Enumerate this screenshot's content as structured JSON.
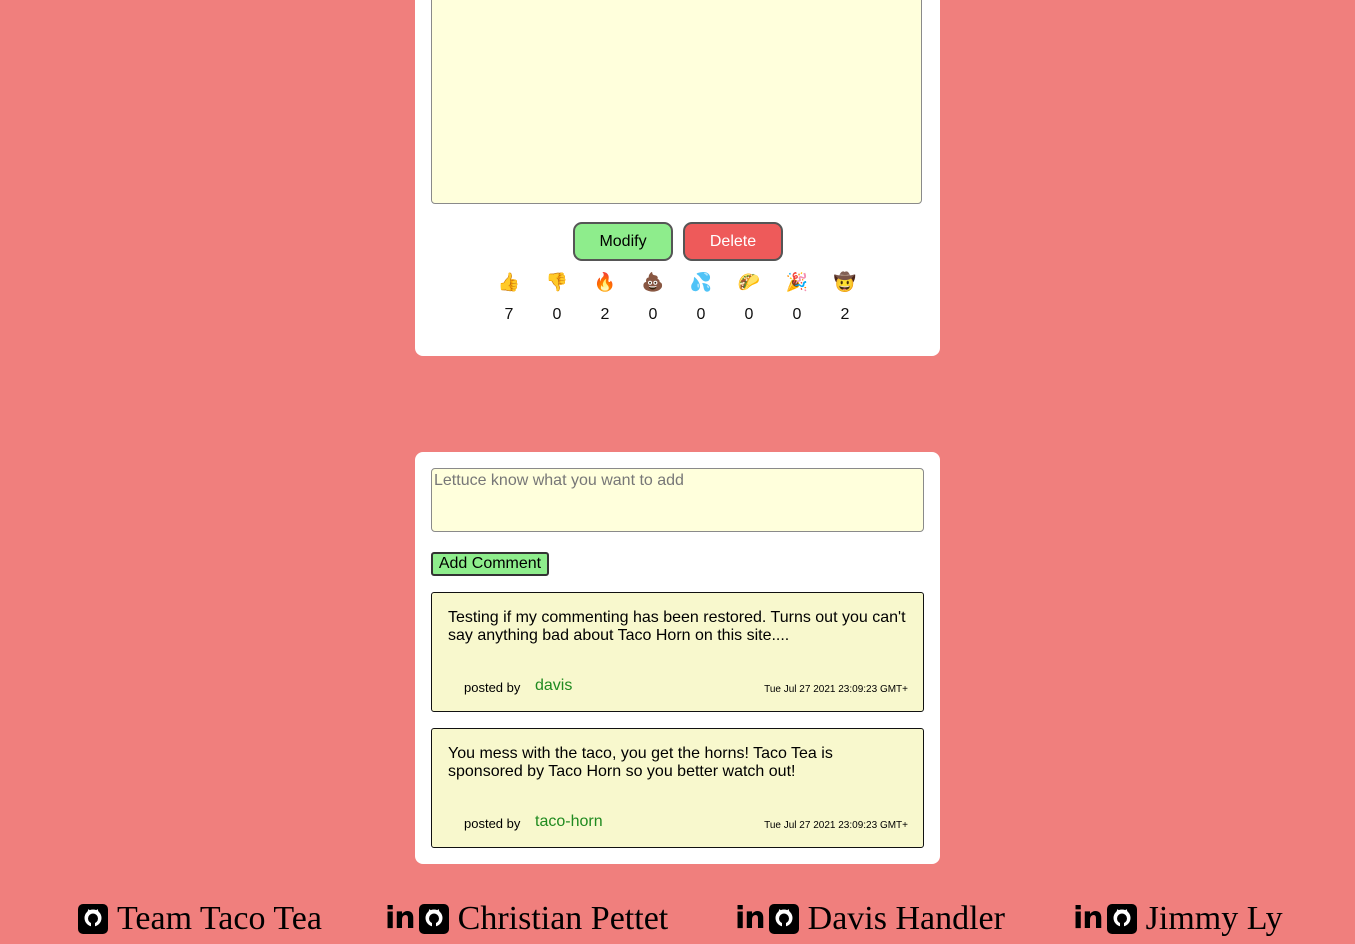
{
  "post": {
    "modify_label": "Modify",
    "delete_label": "Delete",
    "reactions": [
      {
        "emoji": "👍",
        "count": "7",
        "name": "thumbs-up"
      },
      {
        "emoji": "👎",
        "count": "0",
        "name": "thumbs-down"
      },
      {
        "emoji": "🔥",
        "count": "2",
        "name": "fire"
      },
      {
        "emoji": "💩",
        "count": "0",
        "name": "poop"
      },
      {
        "emoji": "💦",
        "count": "0",
        "name": "sweat-droplets"
      },
      {
        "emoji": "🌮",
        "count": "0",
        "name": "taco"
      },
      {
        "emoji": "🎉",
        "count": "0",
        "name": "party-popper"
      },
      {
        "emoji": "🤠",
        "count": "2",
        "name": "cowboy"
      }
    ]
  },
  "comments_section": {
    "placeholder": "Lettuce know what you want to add",
    "add_label": "Add Comment",
    "comments": [
      {
        "text": "Testing if my commenting has been restored. Turns out you can't say anything bad about Taco Horn on this site....",
        "posted_by": "posted by",
        "author": "davis",
        "time": "Tue Jul 27 2021 23:09:23 GMT+"
      },
      {
        "text": "You mess with the taco, you get the horns! Taco Tea is sponsored by Taco Horn so you better watch out!",
        "posted_by": "posted by",
        "author": "taco-horn",
        "time": "Tue Jul 27 2021 23:09:23 GMT+"
      }
    ]
  },
  "footer": {
    "items": [
      {
        "name": "Team Taco Tea",
        "icons": [
          "github-icon"
        ]
      },
      {
        "name": "Christian Pettet",
        "icons": [
          "linkedin-icon",
          "github-icon"
        ]
      },
      {
        "name": "Davis Handler",
        "icons": [
          "linkedin-icon",
          "github-icon"
        ]
      },
      {
        "name": "Jimmy Ly",
        "icons": [
          "linkedin-icon",
          "github-icon"
        ]
      }
    ]
  },
  "colors": {
    "background": "#f07f7d",
    "modify": "#8eed8c",
    "delete": "#ee5a5a",
    "input_bg": "#ffffdc",
    "comment_bg": "#f8f8cd",
    "author": "#1f8a1f"
  }
}
